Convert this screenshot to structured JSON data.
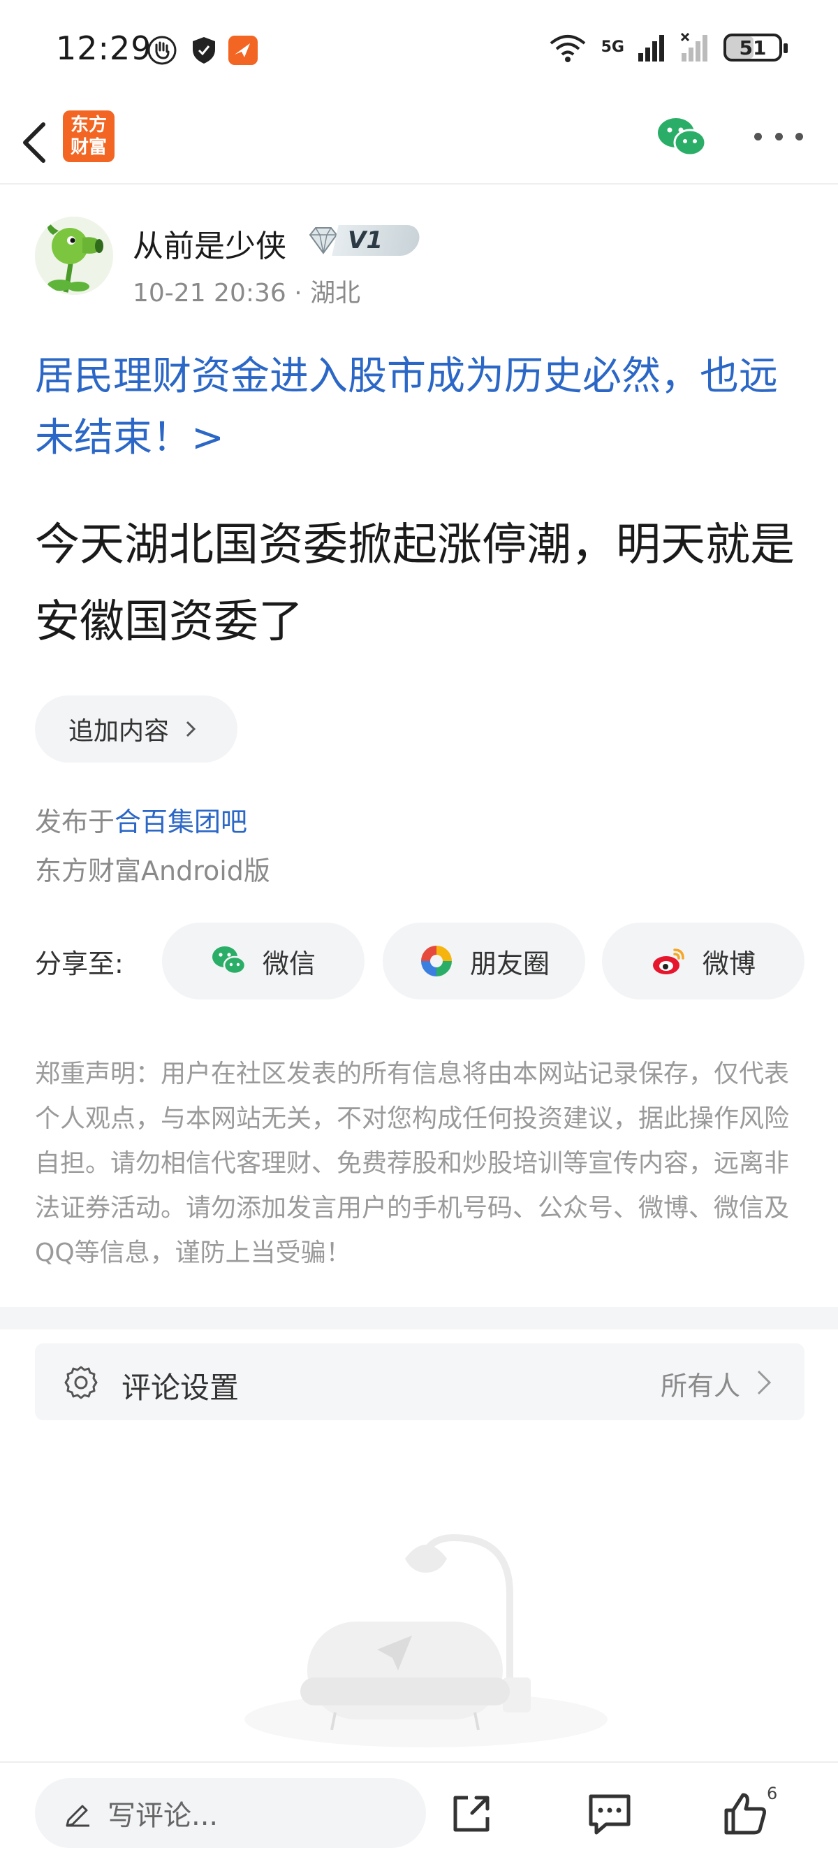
{
  "status_bar": {
    "time": "12:29",
    "network": "5G",
    "battery": "51"
  },
  "nav": {
    "logo_text_line1": "东方",
    "logo_text_line2": "财富"
  },
  "author": {
    "name": "从前是少侠",
    "level": "V1",
    "meta": "10-21 20:36 · 湖北"
  },
  "post": {
    "topic_title": "居民理财资金进入股市成为历史必然，也远未结束！>",
    "body": "今天湖北国资委掀起涨停潮，明天就是安徽国资委了",
    "add_content_label": "追加内容",
    "posted_in_prefix": "发布于",
    "posted_in_link": "合百集团吧",
    "platform": "东方财富Android版"
  },
  "share": {
    "label": "分享至:",
    "wechat": "微信",
    "moments": "朋友圈",
    "weibo": "微博"
  },
  "disclaimer": "郑重声明：用户在社区发表的所有信息将由本网站记录保存，仅代表个人观点，与本网站无关，不对您构成任何投资建议，据此操作风险自担。请勿相信代客理财、免费荐股和炒股培训等宣传内容，远离非法证券活动。请勿添加发言用户的手机号码、公众号、微博、微信及QQ等信息，谨防上当受骗！",
  "comment_settings": {
    "label": "评论设置",
    "value": "所有人"
  },
  "bottom_bar": {
    "comment_placeholder": "写评论...",
    "like_count": "6"
  },
  "colors": {
    "link_blue": "#2b67c6",
    "brand_orange": "#f26522",
    "wechat_green": "#2aae67",
    "weibo_red": "#e6162d"
  }
}
